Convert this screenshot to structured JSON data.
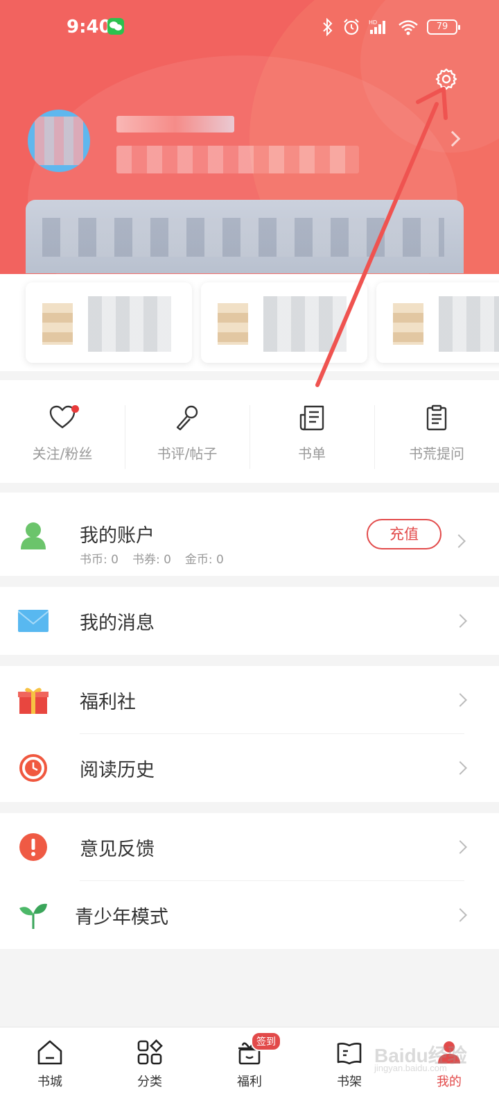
{
  "status_bar": {
    "time": "9:40",
    "battery": "79",
    "icons": [
      "wechat-icon",
      "bluetooth-icon",
      "alarm-icon",
      "signal-icon",
      "wifi-icon",
      "battery-icon"
    ]
  },
  "header": {
    "settings_icon": "gear-icon"
  },
  "shortcuts": [
    {
      "label": "关注/粉丝",
      "icon": "heart-icon",
      "has_dot": true
    },
    {
      "label": "书评/帖子",
      "icon": "microphone-icon"
    },
    {
      "label": "书单",
      "icon": "booklist-icon"
    },
    {
      "label": "书荒提问",
      "icon": "clipboard-icon"
    }
  ],
  "account": {
    "title": "我的账户",
    "stats": [
      "书币: 0",
      "书券: 0",
      "金币: 0"
    ],
    "recharge_label": "充值"
  },
  "menu": {
    "messages": "我的消息",
    "welfare": "福利社",
    "history": "阅读历史",
    "feedback": "意见反馈",
    "teen_mode": "青少年模式"
  },
  "bottom_nav": {
    "tabs": [
      {
        "label": "书城",
        "icon": "home-icon"
      },
      {
        "label": "分类",
        "icon": "category-icon"
      },
      {
        "label": "福利",
        "icon": "gift-icon",
        "badge": "签到"
      },
      {
        "label": "书架",
        "icon": "bookshelf-icon"
      },
      {
        "label": "我的",
        "icon": "profile-icon",
        "active": true
      }
    ]
  },
  "watermark": {
    "logo": "Baidu经验",
    "url": "jingyan.baidu.com"
  },
  "colors": {
    "accent": "#e24a4a",
    "header_bg": "#f2635f"
  }
}
